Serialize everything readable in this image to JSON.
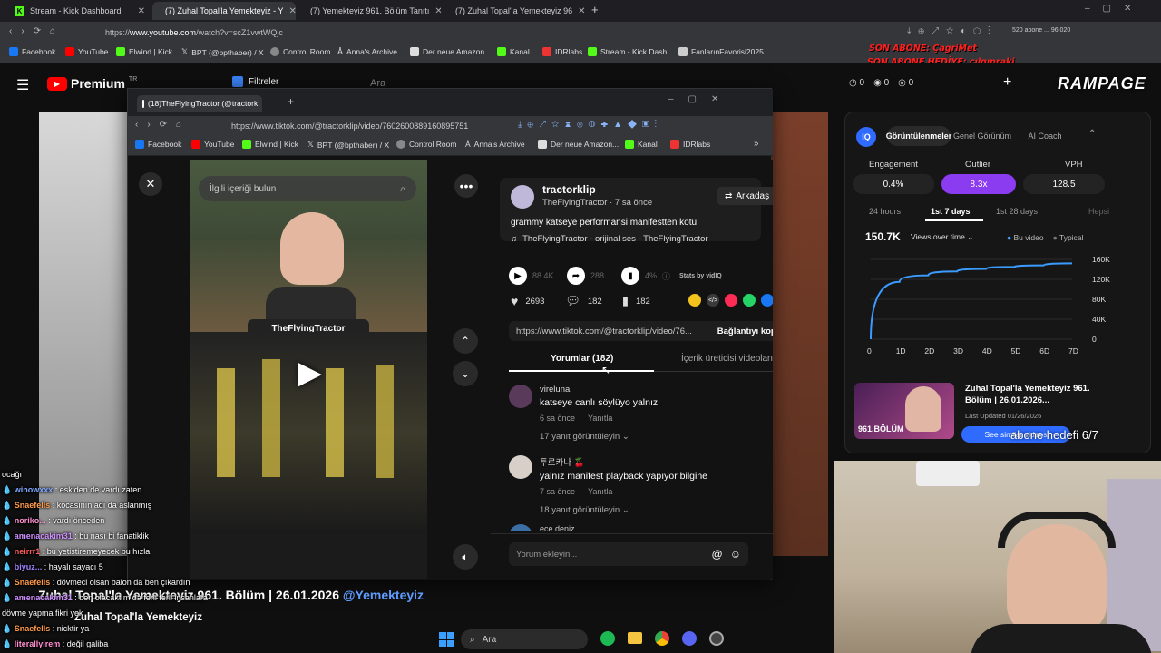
{
  "outer_tabs": [
    {
      "label": "Stream - Kick Dashboard",
      "icon": "kick-icon"
    },
    {
      "label": "(7) Zuhal Topal'la Yemekteyiz - Y",
      "icon": "youtube-icon"
    },
    {
      "label": "(7) Yemekteyiz 961. Bölüm Tanıtı",
      "icon": "youtube-icon"
    },
    {
      "label": "(7) Zuhal Topal'la Yemekteyiz 96",
      "icon": "youtube-icon"
    }
  ],
  "outer_url": {
    "prefix": "https://",
    "host": "www.youtube.com",
    "path": "/watch?v=scZ1vwtWQjc"
  },
  "outer_bookmarks": [
    "Facebook",
    "YouTube",
    "Elwind | Kick",
    "BPT (@bpthaber) / X",
    "Control Room",
    "Anna's Archive",
    "Der neue Amazon...",
    "Kanal",
    "IDRlabs",
    "Stream - Kick Dash...",
    "FanlarınFavorisi2025"
  ],
  "yt": {
    "logo": "Premium",
    "region": "TR",
    "filters": "Filtreler",
    "search_placeholder": "Ara",
    "counter": "0"
  },
  "overlay": {
    "line1": "SON ABONE: ÇagriMet",
    "line2": "SON ABONE HEDİYE: çılgınraki",
    "brand": "RAMPAGE",
    "top_right": "520 abone ... 96.020"
  },
  "tt": {
    "tab_title": "(18)TheFlyingTractor (@tractork",
    "url": "https://www.tiktok.com/@tractorklip/video/7602600889160895751",
    "bookmarks": [
      "Facebook",
      "YouTube",
      "Elwind | Kick",
      "BPT (@bpthaber) / X",
      "Control Room",
      "Anna's Archive",
      "Der neue Amazon...",
      "Kanal",
      "IDRlabs"
    ],
    "search_placeholder": "İlgili içeriği bulun",
    "video_label": "TheFlyingTractor",
    "username": "tractorklip",
    "display_name": "TheFlyingTractor",
    "time_ago": "7 sa önce",
    "follow": "Arkadaş",
    "caption": "grammy katseye performansi manifestten kötü",
    "sound": "TheFlyingTractor - orijinal ses - TheFlyingTractor",
    "views": "88.4K",
    "shares_count": "288",
    "pct": "4%",
    "stats_by": "Stats by vidIQ",
    "likes": "2693",
    "comments": "182",
    "saves": "182",
    "share_url": "https://www.tiktok.com/@tractorklip/video/76...",
    "copy_link": "Bağlantıyı kopy",
    "tab_comments": "Yorumlar (182)",
    "tab_creator": "İçerik üreticisi videoları",
    "comment_placeholder": "Yorum ekleyin...",
    "comment_list": [
      {
        "user": "vireluna",
        "text": "katseye canlı söylüyo yalnız",
        "time": "6 sa önce",
        "reply": "Yanıtla",
        "more": "17 yanıt görüntüleyin"
      },
      {
        "user": "투르카나 🍒",
        "text": "yalnız manifest playback yapıyor bilgine",
        "time": "7 sa önce",
        "reply": "Yanıtla",
        "more": "18 yanıt görüntüleyin"
      },
      {
        "user": "ece.deniz",
        "text": "",
        "time": "",
        "reply": "",
        "more": ""
      }
    ]
  },
  "vidiq": {
    "tabs": [
      "Görüntülenmeler",
      "Genel Görünüm",
      "AI Coach"
    ],
    "metrics": [
      {
        "label": "Engagement",
        "value": "0.4%"
      },
      {
        "label": "Outlier",
        "value": "8.3x"
      },
      {
        "label": "VPH",
        "value": "128.5"
      }
    ],
    "ranges": [
      "24 hours",
      "1st 7 days",
      "1st 28 days",
      "Hepsi"
    ],
    "total": "150.7K",
    "dropdown": "Views over time",
    "legend": [
      "Bu video",
      "Typical"
    ],
    "chart_data": {
      "type": "line",
      "x": [
        "0",
        "1D",
        "2D",
        "3D",
        "4D",
        "5D",
        "6D",
        "7D"
      ],
      "y_ticks": [
        "160K",
        "120K",
        "80K",
        "40K",
        "0"
      ],
      "ylim": [
        0,
        160000
      ],
      "series": [
        {
          "name": "Bu video",
          "values": [
            0,
            115000,
            128000,
            136000,
            141000,
            145000,
            148000,
            152000
          ]
        }
      ]
    },
    "video_title": "Zuhal Topal'la Yemekteyiz 961. Bölüm | 26.01.2026...",
    "thumb_text": "961.BÖLÜM",
    "updated": "Last Updated 01/26/2026",
    "similar": "See similar videos",
    "goal": "abone hedefi 6/7"
  },
  "yt_title": "Zuhal Topal'la Yemekteyiz 961. Bölüm | 26.01.2026",
  "yt_channel_tag": "@Yemekteyiz",
  "yt_channel": "Zuhal Topal'la Yemekteyiz",
  "chat": [
    {
      "user": "",
      "text": "ocağı",
      "color": "#ffffff"
    },
    {
      "user": "winowxxx",
      "text": "eskiden de vardı zaten",
      "color": "#7fa7ff"
    },
    {
      "user": "Snaefells",
      "text": "kocasının adı da aslanmış",
      "color": "#ff9a4a"
    },
    {
      "user": "noriko...",
      "text": "vardı önceden",
      "color": "#ff8fd0"
    },
    {
      "user": "amenacakim31",
      "text": "bu nası bi fanatiklik",
      "color": "#cf8fff"
    },
    {
      "user": "neirrr1",
      "text": "bu yetiştiremeyecek bu hızla",
      "color": "#ff5a5a"
    },
    {
      "user": "biyuz...",
      "text": "hayalı sayacı 5",
      "color": "#a080ff"
    },
    {
      "user": "Snaefells",
      "text": "dövmeci olsan balon da ben çıkardın",
      "color": "#ff9a4a"
    },
    {
      "user": "amenacakim31",
      "text": "ben olacaktım da ferli ferli insanlara",
      "color": "#cf8fff"
    },
    {
      "user": "",
      "text": "dövme yapma fikri yok",
      "color": "#ffffff"
    },
    {
      "user": "Snaefells",
      "text": "nicktir ya",
      "color": "#ff9a4a"
    },
    {
      "user": "literallyirem",
      "text": "değil galiba",
      "color": "#ff8fd0"
    }
  ],
  "taskbar": {
    "search": "Ara"
  }
}
